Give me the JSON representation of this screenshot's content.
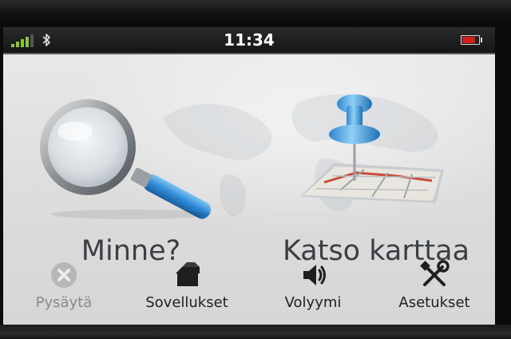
{
  "status_bar": {
    "time": "11:34",
    "signal_bars": 4,
    "bluetooth_icon": "bluetooth-icon",
    "battery_level": 0.8,
    "battery_color": "#d12020",
    "signal_color": "#8cc63f"
  },
  "main": {
    "where_to": {
      "label": "Minne?",
      "icon": "magnifier-icon"
    },
    "view_map": {
      "label": "Katso karttaa",
      "icon": "map-pushpin-icon"
    }
  },
  "bottom_menu": {
    "stop": {
      "label": "Pysäytä",
      "icon": "stop-x-icon",
      "enabled": false
    },
    "apps": {
      "label": "Sovellukset",
      "icon": "toolbox-icon"
    },
    "volume": {
      "label": "Volyymi",
      "icon": "speaker-icon"
    },
    "settings": {
      "label": "Asetukset",
      "icon": "tools-icon"
    }
  },
  "colors": {
    "label_text": "#3a3f44",
    "accent_blue": "#3c9be0"
  }
}
